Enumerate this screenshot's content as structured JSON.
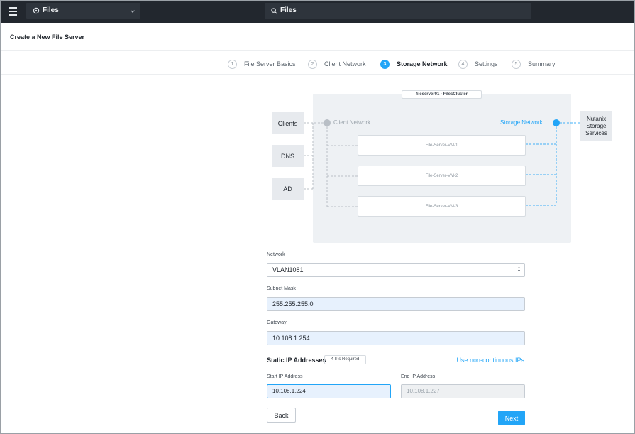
{
  "topbar": {
    "app_name": "Files",
    "search_text": "Files"
  },
  "page": {
    "title": "Create a New File Server"
  },
  "wizard": {
    "steps": [
      {
        "num": "1",
        "label": "File Server Basics",
        "state": "done"
      },
      {
        "num": "2",
        "label": "Client Network",
        "state": "done"
      },
      {
        "num": "3",
        "label": "Storage Network",
        "state": "active"
      },
      {
        "num": "4",
        "label": "Settings",
        "state": "pending"
      },
      {
        "num": "5",
        "label": "Summary",
        "state": "pending"
      }
    ]
  },
  "diagram": {
    "cluster_label": "fileserver01 - FilesCluster",
    "left_boxes": [
      "Clients",
      "DNS",
      "AD"
    ],
    "client_network_label": "Client Network",
    "storage_network_label": "Storage Network",
    "storage_services_label": "Nutanix Storage Services",
    "vms": [
      "File-Server-VM-1",
      "File-Server-VM-2",
      "File-Server-VM-3"
    ]
  },
  "form": {
    "network_label": "Network",
    "network_value": "VLAN1081",
    "subnet_label": "Subnet Mask",
    "subnet_value": "255.255.255.0",
    "gateway_label": "Gateway",
    "gateway_value": "10.108.1.254",
    "static_ip_label": "Static IP Addresses",
    "ips_required": "4 IPs Required",
    "noncontinuous_link": "Use non-continuous IPs",
    "start_ip_label": "Start IP Address",
    "start_ip_value": "10.108.1.224",
    "end_ip_label": "End IP Address",
    "end_ip_value": "10.108.1.227"
  },
  "buttons": {
    "back": "Back",
    "next": "Next"
  },
  "colors": {
    "topbar": "#22272e",
    "accent": "#22a5f7",
    "client_network": "#b9bfc6",
    "storage_network": "#22a5f7"
  }
}
